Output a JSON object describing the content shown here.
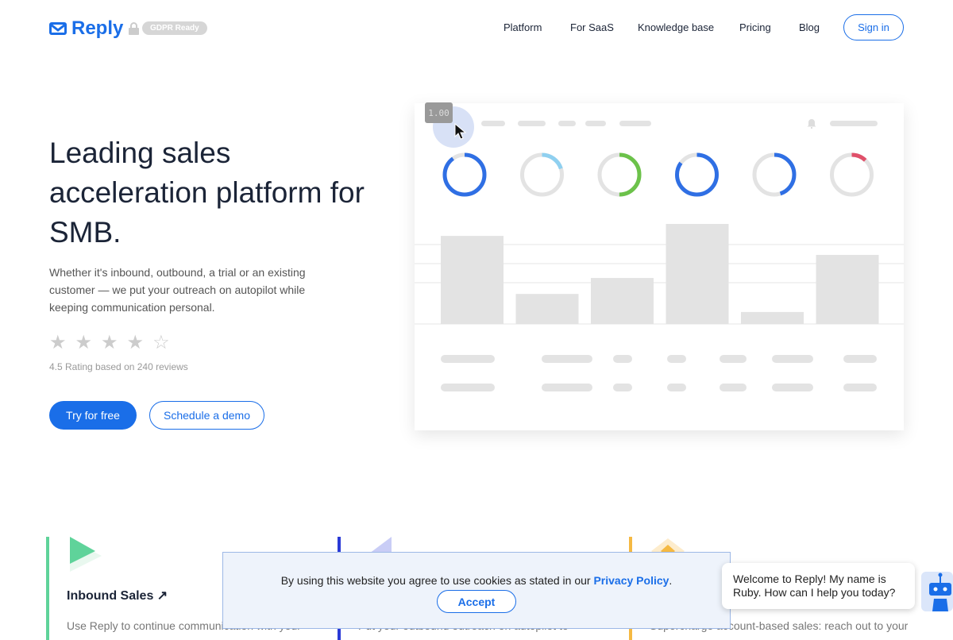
{
  "header": {
    "logo": "Reply",
    "gdpr_badge": "GDPR Ready",
    "nav": [
      "Platform",
      "For SaaS",
      "Knowledge base",
      "Pricing",
      "Blog"
    ],
    "sign_in": "Sign in"
  },
  "hero": {
    "title": "Leading sales acceleration platform for SMB.",
    "subtitle": "Whether it's inbound, outbound, a trial or an existing customer — we put your outreach on autopilot while keeping communication personal.",
    "rating_value": 4.5,
    "rating_text": "4.5 Rating based on 240 reviews",
    "primary_button": "Try for free",
    "secondary_button": "Schedule a demo"
  },
  "dashboard": {
    "tooltip": "1.00",
    "donuts": [
      {
        "fill": 0.9,
        "color": "#2f6fe4"
      },
      {
        "fill": 0.2,
        "color": "#8fd0f0"
      },
      {
        "fill": 0.5,
        "color": "#6cc24a"
      },
      {
        "fill": 0.85,
        "color": "#2f6fe4"
      },
      {
        "fill": 0.45,
        "color": "#2f6fe4"
      },
      {
        "fill": 0.12,
        "color": "#e0506a"
      }
    ],
    "bars": [
      0.88,
      0.3,
      0.46,
      1.0,
      0.12,
      0.69
    ]
  },
  "features": [
    {
      "title": "Inbound Sales ↗",
      "desc": "Use Reply to continue communication with your",
      "color": "#5fd39a"
    },
    {
      "title": "",
      "desc": "Put your outbound outreach on autopilot to",
      "color": "#2a3ad6"
    },
    {
      "title": "",
      "desc": "Supercharge account-based sales: reach out to your",
      "color": "#f5b942"
    }
  ],
  "cookie": {
    "text": "By using this website you agree to use cookies as stated in our ",
    "link": "Privacy Policy",
    "accept": "Accept"
  },
  "chat": {
    "message": "Welcome to Reply! My name is Ruby. How can I help you today?"
  }
}
